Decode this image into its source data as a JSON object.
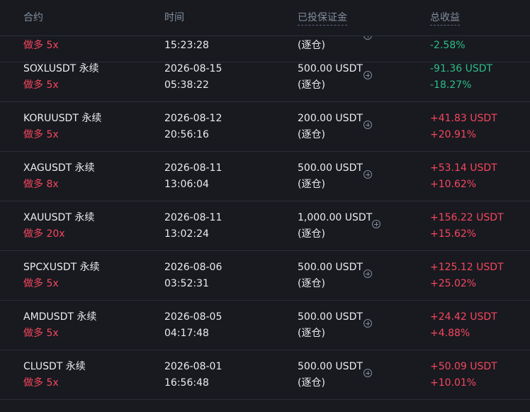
{
  "header": {
    "contract": "合约",
    "time": "时间",
    "margin": "已投保证金",
    "pnl": "总收益"
  },
  "partial_row": {
    "side": "做多 5x",
    "time": "15:23:28",
    "mode": "(逐仓)",
    "pct": "-2.58%"
  },
  "rows": [
    {
      "symbol": "SOXLUSDT 永续",
      "side": "做多 5x",
      "date": "2026-08-15",
      "time": "05:38:22",
      "margin": "500.00 USDT",
      "mode": "(逐仓)",
      "pnl": "-91.36 USDT",
      "pct": "-18.27%",
      "dir": "neg"
    },
    {
      "symbol": "KORUUSDT 永续",
      "side": "做多 5x",
      "date": "2026-08-12",
      "time": "20:56:16",
      "margin": "200.00 USDT",
      "mode": "(逐仓)",
      "pnl": "+41.83 USDT",
      "pct": "+20.91%",
      "dir": "pos"
    },
    {
      "symbol": "XAGUSDT 永续",
      "side": "做多 8x",
      "date": "2026-08-11",
      "time": "13:06:04",
      "margin": "500.00 USDT",
      "mode": "(逐仓)",
      "pnl": "+53.14 USDT",
      "pct": "+10.62%",
      "dir": "pos"
    },
    {
      "symbol": "XAUUSDT 永续",
      "side": "做多 20x",
      "date": "2026-08-11",
      "time": "13:02:24",
      "margin": "1,000.00 USDT",
      "mode": "(逐仓)",
      "pnl": "+156.22 USDT",
      "pct": "+15.62%",
      "dir": "pos"
    },
    {
      "symbol": "SPCXUSDT 永续",
      "side": "做多 5x",
      "date": "2026-08-06",
      "time": "03:52:31",
      "margin": "500.00 USDT",
      "mode": "(逐仓)",
      "pnl": "+125.12 USDT",
      "pct": "+25.02%",
      "dir": "pos"
    },
    {
      "symbol": "AMDUSDT 永续",
      "side": "做多 5x",
      "date": "2026-08-05",
      "time": "04:17:48",
      "margin": "500.00 USDT",
      "mode": "(逐仓)",
      "pnl": "+24.42 USDT",
      "pct": "+4.88%",
      "dir": "pos"
    },
    {
      "symbol": "CLUSDT 永续",
      "side": "做多 5x",
      "date": "2026-08-01",
      "time": "16:56:48",
      "margin": "500.00 USDT",
      "mode": "(逐仓)",
      "pnl": "+50.09 USDT",
      "pct": "+10.01%",
      "dir": "pos"
    }
  ],
  "colors": {
    "positive": "#f6465d",
    "negative": "#2ebd85",
    "background": "#181a20"
  },
  "icons": {
    "add_margin": "plus-circle-icon"
  }
}
